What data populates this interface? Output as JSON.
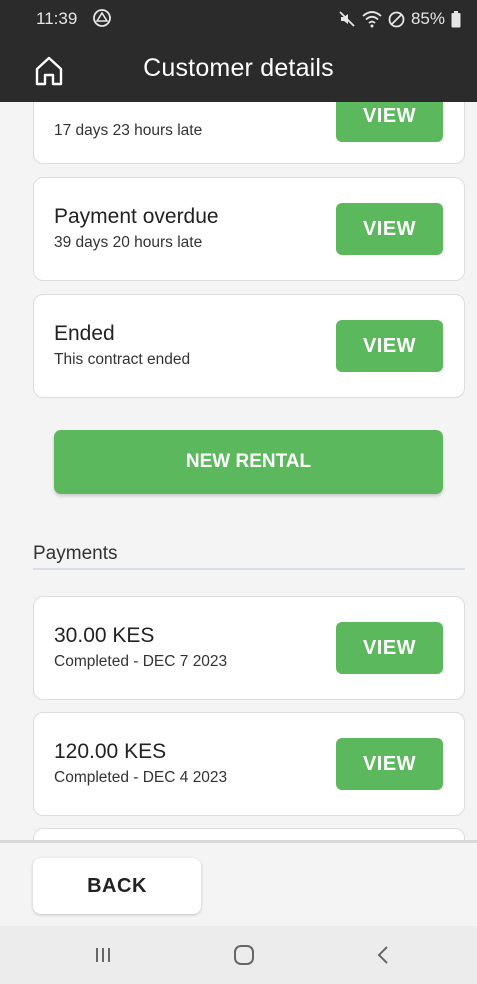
{
  "status_bar": {
    "time": "11:39",
    "battery": "85%",
    "icons": [
      "sync-icon",
      "mute-icon",
      "wifi-icon",
      "do-not-disturb-icon",
      "battery-icon"
    ]
  },
  "app_bar": {
    "title": "Customer details",
    "home_icon": "home-icon"
  },
  "contracts": [
    {
      "title": "",
      "subtitle": "17 days 23 hours late",
      "button": "VIEW"
    },
    {
      "title": "Payment overdue",
      "subtitle": "39 days 20 hours late",
      "button": "VIEW"
    },
    {
      "title": "Ended",
      "subtitle": "This contract ended",
      "button": "VIEW"
    }
  ],
  "new_rental_label": "NEW RENTAL",
  "payments": {
    "title": "Payments",
    "items": [
      {
        "amount": "30.00 KES",
        "subtitle": "Completed - DEC 7 2023",
        "button": "VIEW"
      },
      {
        "amount": "120.00 KES",
        "subtitle": "Completed - DEC 4 2023",
        "button": "VIEW"
      }
    ]
  },
  "footer": {
    "back_label": "BACK"
  },
  "colors": {
    "accent": "#5cb85c",
    "app_bar": "#2b2b2b",
    "background": "#f4f4f4"
  },
  "nav": {
    "icons": [
      "recents-icon",
      "home-nav-icon",
      "back-nav-icon"
    ]
  }
}
